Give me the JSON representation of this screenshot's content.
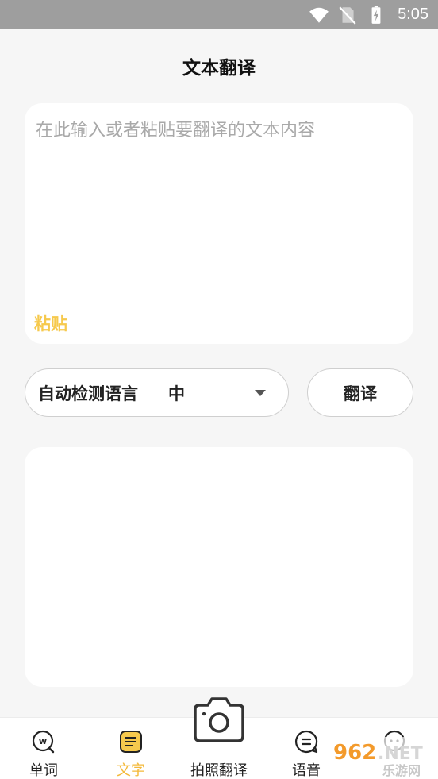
{
  "status_bar": {
    "time": "5:05"
  },
  "header": {
    "title": "文本翻译"
  },
  "input": {
    "placeholder": "在此输入或者粘贴要翻译的文本内容",
    "value": "",
    "paste_label": "粘贴"
  },
  "language": {
    "source": "自动检测语言",
    "target": "中"
  },
  "translate_label": "翻译",
  "output": {
    "text": ""
  },
  "bottom_nav": {
    "items": [
      {
        "label": "单词",
        "icon": "word-search-icon"
      },
      {
        "label": "文字",
        "icon": "document-icon",
        "active": true
      },
      {
        "label": "拍照翻译",
        "icon": "camera-icon"
      },
      {
        "label": "语音",
        "icon": "speech-bubble-icon"
      },
      {
        "label": "",
        "icon": "chat-icon"
      }
    ]
  },
  "watermark": {
    "text": "962.NET 乐游网"
  },
  "colors": {
    "accent": "#f6c94d",
    "active_nav": "#f4b93a",
    "background": "#f6f6f6",
    "status_bar": "#9e9e9e"
  }
}
